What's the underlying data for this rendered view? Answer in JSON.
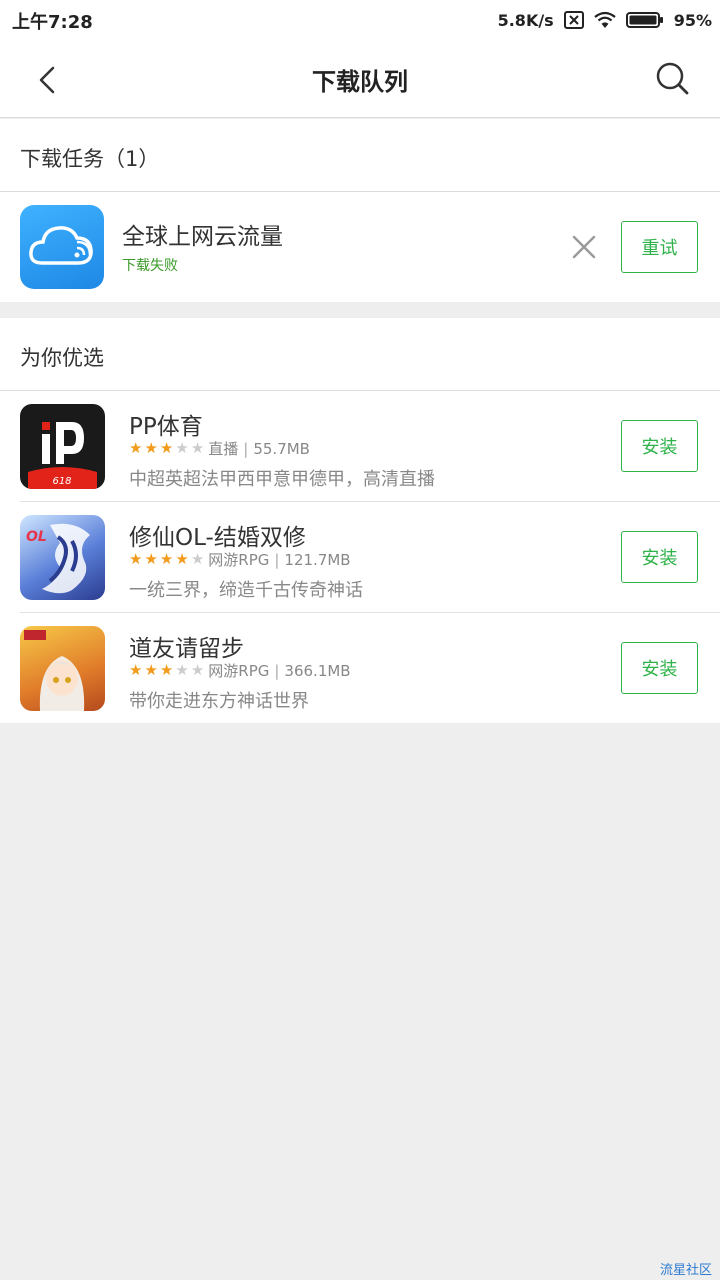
{
  "status_bar": {
    "time": "上午7:28",
    "net_speed": "5.8K/s",
    "battery": "95%"
  },
  "header": {
    "title": "下载队列",
    "back_icon": "back-icon",
    "search_icon": "search-icon"
  },
  "tasks": {
    "section_title": "下载任务（1）",
    "items": [
      {
        "name": "全球上网云流量",
        "status": "下载失败",
        "retry_label": "重试"
      }
    ]
  },
  "recommend": {
    "section_title": "为你优选",
    "items": [
      {
        "name": "PP体育",
        "rating": 3,
        "category": "直播",
        "size": "55.7MB",
        "desc": "中超英超法甲西甲意甲德甲，高清直播",
        "button": "安装"
      },
      {
        "name": "修仙OL-结婚双修",
        "rating": 4,
        "category": "网游RPG",
        "size": "121.7MB",
        "desc": "一统三界，缔造千古传奇神话",
        "button": "安装"
      },
      {
        "name": "道友请留步",
        "rating": 3,
        "category": "网游RPG",
        "size": "366.1MB",
        "desc": "带你走进东方神话世界",
        "button": "安装"
      }
    ]
  },
  "watermark": "流星社区",
  "colors": {
    "accent": "#2fb24a",
    "fail": "#3a9a28",
    "star": "#f29b1d"
  }
}
